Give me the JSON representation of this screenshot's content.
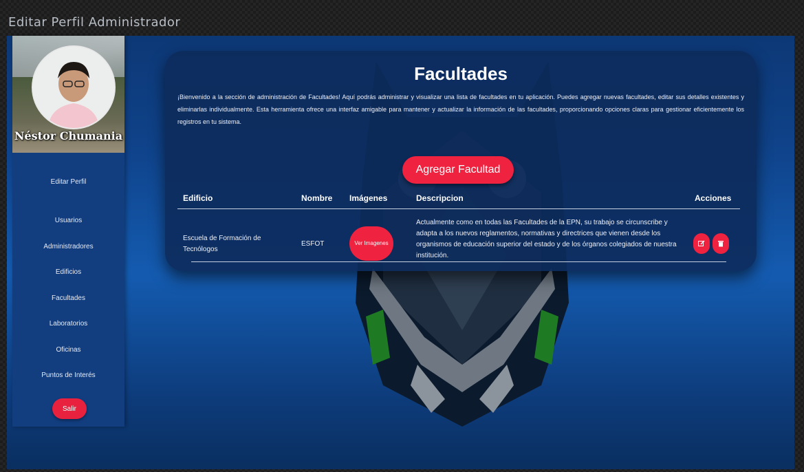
{
  "window": {
    "title": "Editar Perfil Administrador"
  },
  "sidebar": {
    "profile_name": "Néstor Chumania",
    "items": [
      {
        "label": "Editar Perfil"
      },
      {
        "label": "Usuarios"
      },
      {
        "label": "Administradores"
      },
      {
        "label": "Edificios"
      },
      {
        "label": "Facultades"
      },
      {
        "label": "Laboratorios"
      },
      {
        "label": "Oficinas"
      },
      {
        "label": "Puntos de Interés"
      }
    ],
    "logout_label": "Salir"
  },
  "main": {
    "title": "Facultades",
    "description": "¡Bienvenido a la sección de administración de Facultades! Aquí podrás administrar y visualizar una lista de facultades en tu aplicación. Puedes agregar nuevas facultades, editar sus detalles existentes y eliminarlas individualmente. Esta herramienta ofrece una interfaz amigable para mantener y actualizar la información de las facultades, proporcionando opciones claras para gestionar eficientemente los registros en tu sistema.",
    "add_button": "Agregar Facultad",
    "table": {
      "headers": [
        "Edificio",
        "Nombre",
        "Imágenes",
        "Descripcion",
        "Acciones"
      ],
      "rows": [
        {
          "edificio": "Escuela de Formación de Tecnólogos",
          "nombre": "ESFOT",
          "imagenes_button": "Ver Imagenes",
          "descripcion": "Actualmente como en todas las Facultades de la EPN, su trabajo se circunscribe y adapta a los nuevos reglamentos, normativas y directrices que vienen desde los organismos de educación superior del estado y de los órganos colegiados de nuestra institución."
        }
      ]
    }
  },
  "icons": {
    "edit": "edit-icon",
    "delete": "trash-icon"
  },
  "colors": {
    "accent": "#ef2240",
    "card_bg": "#0d2b5c",
    "background": "#0f4289"
  }
}
